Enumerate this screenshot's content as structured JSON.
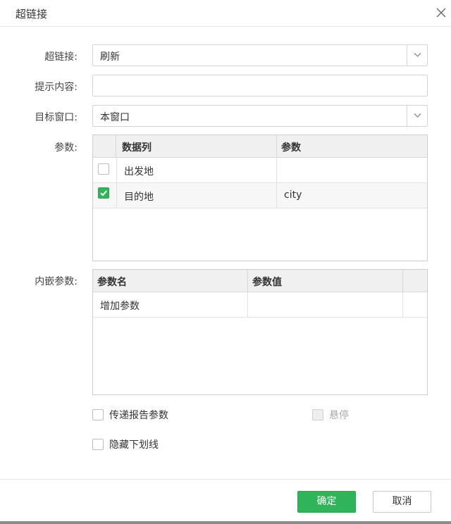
{
  "dialog": {
    "title": "超链接",
    "close_icon": "close-icon"
  },
  "form": {
    "hyperlink_label": "超链接:",
    "hyperlink_value": "刷新",
    "tooltip_label": "提示内容:",
    "tooltip_value": "",
    "target_label": "目标窗口:",
    "target_value": "本窗口",
    "params_label": "参数:",
    "embedded_label": "内嵌参数:"
  },
  "params_table": {
    "columns": [
      "数据列",
      "参数"
    ],
    "rows": [
      {
        "checked": false,
        "column": "出发地",
        "param": ""
      },
      {
        "checked": true,
        "column": "目的地",
        "param": "city"
      }
    ]
  },
  "embedded_table": {
    "columns": [
      "参数名",
      "参数值"
    ],
    "rows": [
      {
        "name": "增加参数",
        "value": ""
      }
    ]
  },
  "options": {
    "pass_report_params": "传递报告参数",
    "hover": "悬停",
    "hide_underline": "隐藏下划线"
  },
  "buttons": {
    "ok": "确定",
    "cancel": "取消"
  },
  "colors": {
    "accent": "#2fb45a",
    "header_bg": "#f0f0f0"
  }
}
